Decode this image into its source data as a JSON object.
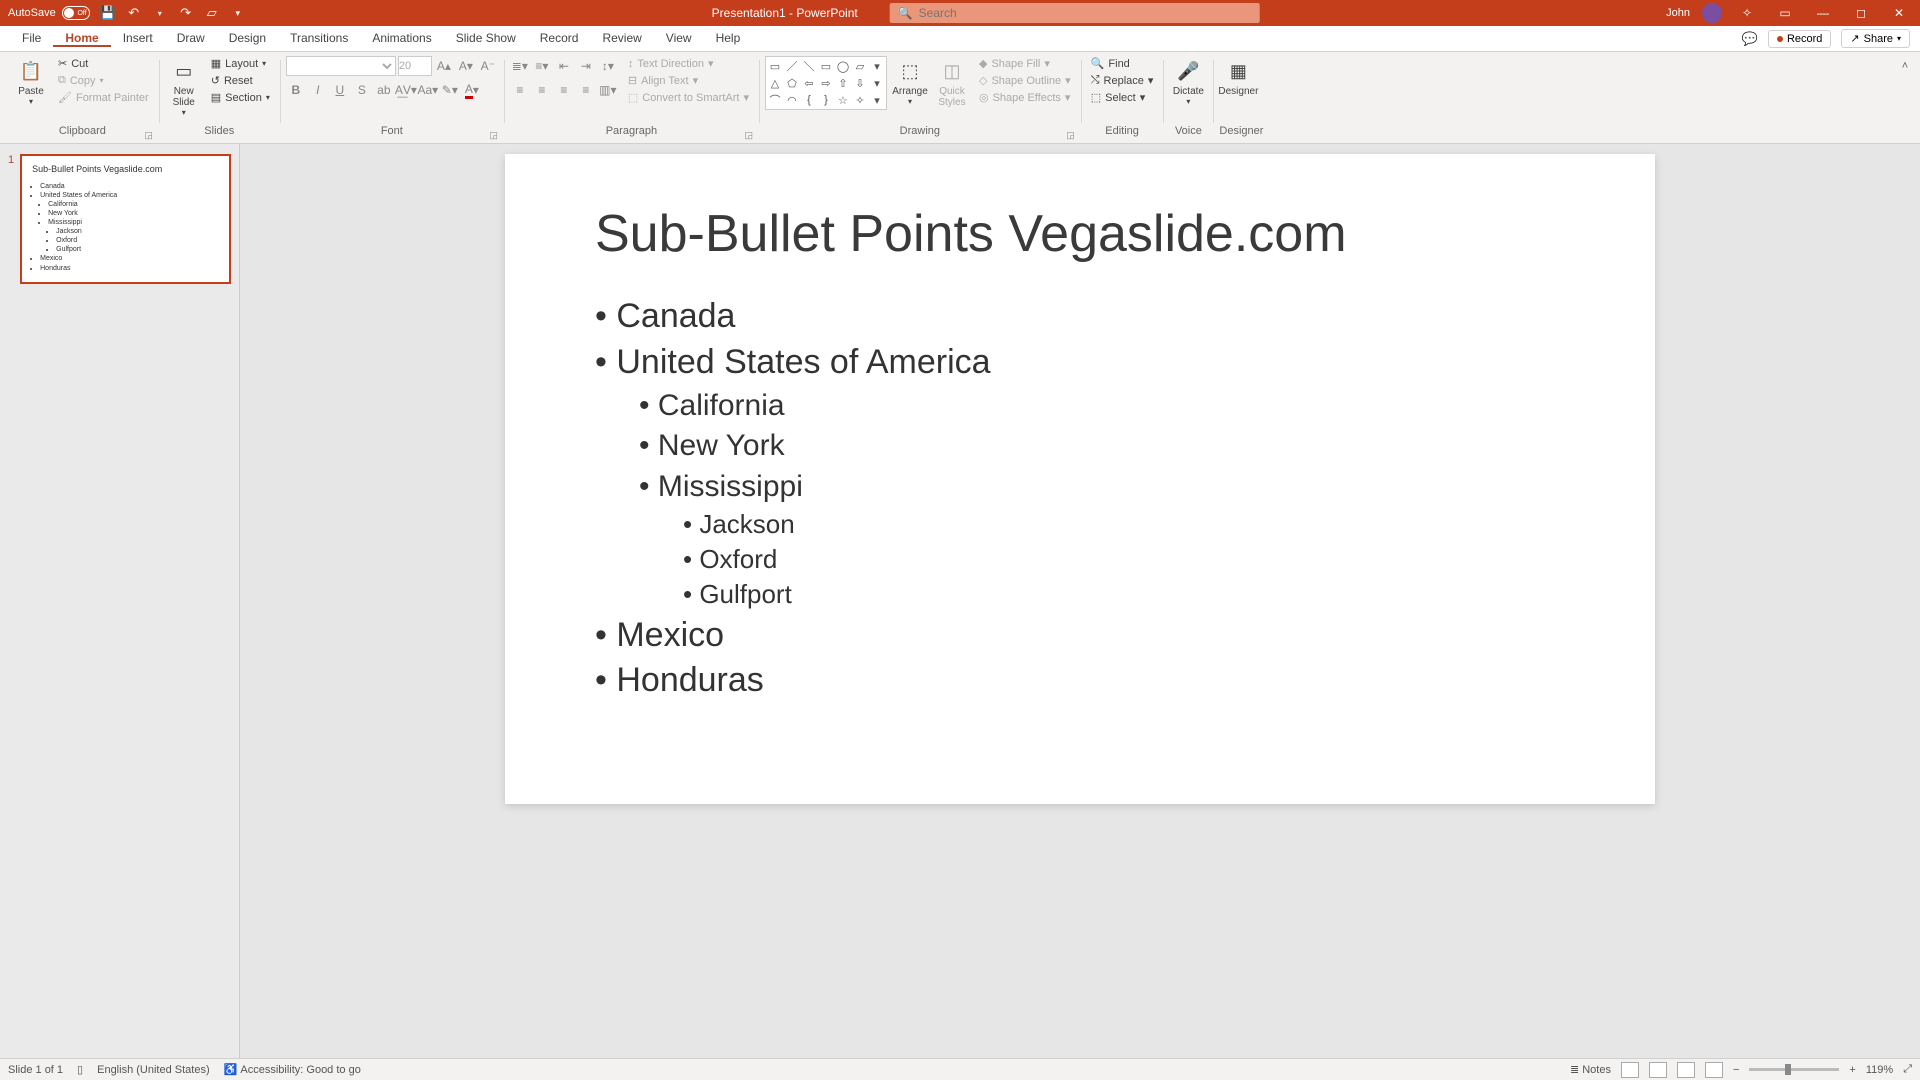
{
  "titlebar": {
    "autosave_label": "AutoSave",
    "autosave_state": "Off",
    "doc_title": "Presentation1  -  PowerPoint",
    "search_placeholder": "Search",
    "user_name": "John"
  },
  "tabs": {
    "items": [
      "File",
      "Home",
      "Insert",
      "Draw",
      "Design",
      "Transitions",
      "Animations",
      "Slide Show",
      "Record",
      "Review",
      "View",
      "Help"
    ],
    "active_index": 1,
    "comments_label": "",
    "record_label": "Record",
    "share_label": "Share"
  },
  "ribbon": {
    "clipboard": {
      "paste": "Paste",
      "cut": "Cut",
      "copy": "Copy",
      "format_painter": "Format Painter",
      "label": "Clipboard"
    },
    "slides": {
      "new_slide": "New\nSlide",
      "layout": "Layout",
      "reset": "Reset",
      "section": "Section",
      "label": "Slides"
    },
    "font": {
      "size": "20",
      "label": "Font"
    },
    "paragraph": {
      "text_direction": "Text Direction",
      "align_text": "Align Text",
      "convert_smartart": "Convert to SmartArt",
      "label": "Paragraph"
    },
    "drawing": {
      "arrange": "Arrange",
      "quick_styles": "Quick\nStyles",
      "shape_fill": "Shape Fill",
      "shape_outline": "Shape Outline",
      "shape_effects": "Shape Effects",
      "label": "Drawing"
    },
    "editing": {
      "find": "Find",
      "replace": "Replace",
      "select": "Select",
      "label": "Editing"
    },
    "voice": {
      "dictate": "Dictate",
      "label": "Voice"
    },
    "designer": {
      "designer": "Designer",
      "label": "Designer"
    }
  },
  "slide": {
    "number": "1",
    "title": "Sub-Bullet Points Vegaslide.com",
    "bullets": [
      {
        "text": "Canada"
      },
      {
        "text": "United States of America",
        "children": [
          {
            "text": "California"
          },
          {
            "text": "New York"
          },
          {
            "text": "Mississippi",
            "children": [
              {
                "text": "Jackson"
              },
              {
                "text": "Oxford"
              },
              {
                "text": "Gulfport"
              }
            ]
          }
        ]
      },
      {
        "text": "Mexico"
      },
      {
        "text": "Honduras"
      }
    ]
  },
  "statusbar": {
    "slide_info": "Slide 1 of 1",
    "language": "English (United States)",
    "accessibility": "Accessibility: Good to go",
    "notes": "Notes",
    "zoom": "119%"
  }
}
